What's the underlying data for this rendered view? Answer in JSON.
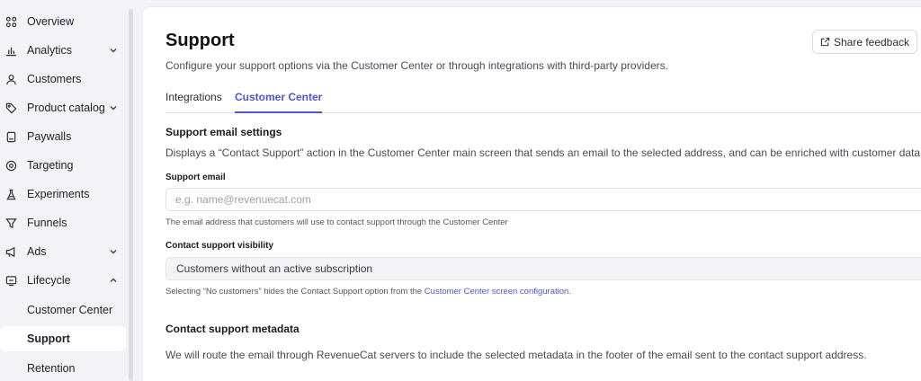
{
  "sidebar": {
    "items": [
      {
        "label": "Overview",
        "icon": "grid-icon"
      },
      {
        "label": "Analytics",
        "icon": "bar-chart-icon",
        "expandable": true
      },
      {
        "label": "Customers",
        "icon": "user-icon"
      },
      {
        "label": "Product catalog",
        "icon": "tag-icon",
        "expandable": true
      },
      {
        "label": "Paywalls",
        "icon": "paywall-icon"
      },
      {
        "label": "Targeting",
        "icon": "target-icon"
      },
      {
        "label": "Experiments",
        "icon": "flask-icon"
      },
      {
        "label": "Funnels",
        "icon": "funnel-icon"
      },
      {
        "label": "Ads",
        "icon": "megaphone-icon",
        "expandable": true
      },
      {
        "label": "Lifecycle",
        "icon": "lifecycle-icon",
        "expanded": true
      }
    ],
    "subitems": [
      {
        "label": "Customer Center"
      },
      {
        "label": "Support",
        "active": true
      },
      {
        "label": "Retention"
      }
    ]
  },
  "page": {
    "title": "Support",
    "description": "Configure your support options via the Customer Center or through integrations with third-party providers.",
    "share_feedback_label": "Share feedback"
  },
  "tabs": [
    {
      "label": "Integrations",
      "active": false
    },
    {
      "label": "Customer Center",
      "active": true
    }
  ],
  "email_settings": {
    "title": "Support email settings",
    "description": "Displays a “Contact Support” action in the Customer Center main screen that sends an email to the selected address, and can be enriched with customer data.",
    "email_label": "Support email",
    "email_placeholder": "e.g. name@revenuecat.com",
    "email_value": "",
    "email_hint": "The email address that customers will use to contact support through the Customer Center",
    "visibility_label": "Contact support visibility",
    "visibility_value": "Customers without an active subscription",
    "visibility_hint_prefix": "Selecting “No customers” hides the Contact Support option from the ",
    "visibility_hint_link": "Customer Center screen configuration",
    "visibility_hint_suffix": "."
  },
  "metadata": {
    "title": "Contact support metadata",
    "description": "We will route the email through RevenueCat servers to include the selected metadata in the footer of the email sent to the contact support address."
  },
  "colors": {
    "accent": "#4f56c8",
    "sidebar_bg": "#f3f2f7",
    "main_bg": "#ffffff"
  }
}
